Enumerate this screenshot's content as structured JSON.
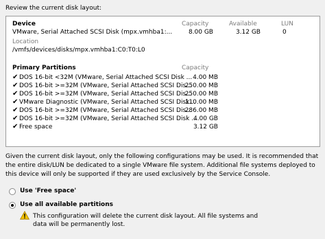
{
  "header": {
    "title": "Review the current disk layout:"
  },
  "device_section": {
    "device_header": "Device",
    "capacity_header": "Capacity",
    "available_header": "Available",
    "lun_header": "LUN",
    "device_name": "VMware, Serial Attached SCSI Disk (mpx.vmhba1:...",
    "capacity": "8.00 GB",
    "available": "3.12 GB",
    "lun": "0",
    "location_label": "Location",
    "location_value": "/vmfs/devices/disks/mpx.vmhba1:C0:T0:L0"
  },
  "partitions": {
    "header": "Primary Partitions",
    "capacity_header": "Capacity",
    "rows": [
      {
        "name": "DOS 16-bit <32M (VMware, Serial Attached SCSI Disk ...",
        "size": "4.00 MB"
      },
      {
        "name": "DOS 16-bit >=32M (VMware, Serial Attached SCSI Dis...",
        "size": "250.00 MB"
      },
      {
        "name": "DOS 16-bit >=32M (VMware, Serial Attached SCSI Dis...",
        "size": "250.00 MB"
      },
      {
        "name": "VMware Diagnostic (VMware, Serial Attached SCSI Disk...",
        "size": "110.00 MB"
      },
      {
        "name": "DOS 16-bit >=32M (VMware, Serial Attached SCSI Dis...",
        "size": "286.00 MB"
      },
      {
        "name": "DOS 16-bit >=32M (VMware, Serial Attached SCSI Disk ...",
        "size": "4.00 GB"
      },
      {
        "name": "Free space",
        "size": "3.12 GB"
      }
    ]
  },
  "info_text": "Given the current disk layout, only the following configurations may be used. It is recommended that the entire disk/LUN be dedicated to a single VMware file system. Additional file systems deployed to this device will only be supported if they are used exclusively by the Service Console.",
  "options": {
    "free_space_label": "Use 'Free space'",
    "free_space_selected": false,
    "all_partitions_label": "Use all available partitions",
    "all_partitions_selected": true
  },
  "warning": {
    "text": "This configuration will delete the current disk layout. All file systems and data will be permanently lost.",
    "icon": "warning-icon"
  },
  "colors": {
    "grey_text": "#7c7c7c",
    "warning_fill": "#f5c400"
  }
}
